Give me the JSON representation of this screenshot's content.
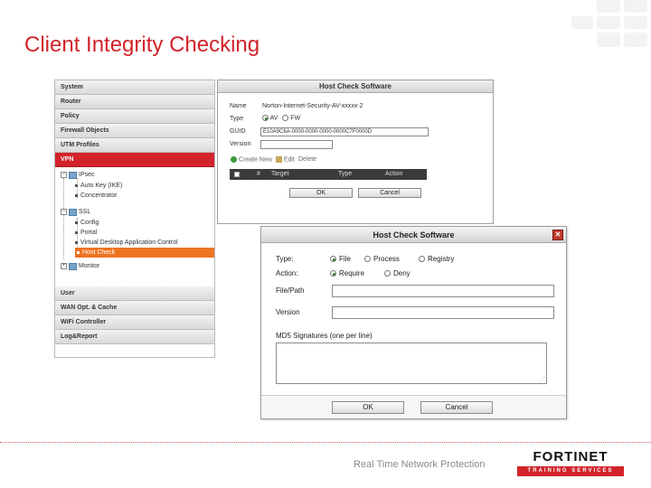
{
  "slide": {
    "title": "Client Integrity Checking",
    "tagline": "Real Time Network Protection"
  },
  "logo": {
    "brand": "FORTINET",
    "subtitle": "TRAINING SERVICES"
  },
  "nav": {
    "top_items": [
      "System",
      "Router",
      "Policy",
      "Firewall Objects",
      "UTM Profiles"
    ],
    "active_item": "VPN",
    "tree": {
      "ipsec": "IPsec",
      "ipsec_children": [
        "Auto Key (IKE)",
        "Concentrator"
      ],
      "ssl": "SSL",
      "ssl_children": [
        "Config",
        "Portal",
        "Virtual Desktop Application Control"
      ],
      "selected_child": "Host Check",
      "monitor": "Monitor"
    },
    "bottom_items": [
      "User",
      "WAN Opt. & Cache",
      "WiFi Controller",
      "Log&Report"
    ]
  },
  "dialog_back": {
    "title": "Host Check Software",
    "name_label": "Name",
    "name_value": "Norton-Internet-Security-AV-xxxxx-2",
    "type_label": "Type",
    "type_option_1": "AV",
    "type_option_2": "FW",
    "guid_label": "GUID",
    "guid_value": "E10A9C6A-0000-0000-0000-0000C7F0000D",
    "version_label": "Version",
    "create_new": "Create New",
    "edit": "Edit",
    "delete": "Delete",
    "columns": [
      "#",
      "Target",
      "Type",
      "Action"
    ],
    "ok": "OK",
    "cancel": "Cancel"
  },
  "dialog_front": {
    "title": "Host Check Software",
    "close_icon": "close-icon",
    "type_label": "Type:",
    "type_options": [
      "File",
      "Process",
      "Registry"
    ],
    "type_selected": "File",
    "action_label": "Action:",
    "action_options": [
      "Require",
      "Deny"
    ],
    "action_selected": "Require",
    "filepath_label": "File/Path",
    "version_label": "Version",
    "md5_label": "MD5 Signatures (one per line)",
    "ok": "OK",
    "cancel": "Cancel"
  },
  "colors": {
    "brand_red": "#d2232a",
    "selection_orange": "#ee7422"
  }
}
